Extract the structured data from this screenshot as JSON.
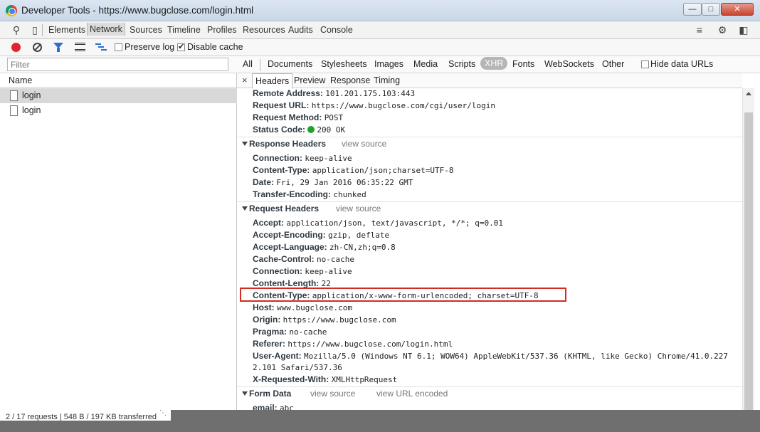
{
  "window": {
    "title": "Developer Tools - https://www.bugclose.com/login.html",
    "min_label": "▭",
    "max_label": "□",
    "close_label": "✕"
  },
  "tabbar": {
    "tabs": [
      "Elements",
      "Network",
      "Sources",
      "Timeline",
      "Profiles",
      "Resources",
      "Audits",
      "Console"
    ],
    "active_tab": "Network"
  },
  "toolbar": {
    "preserve_log_label": "Preserve log",
    "preserve_log_checked": false,
    "disable_cache_label": "Disable cache",
    "disable_cache_checked": true
  },
  "filter": {
    "placeholder": "Filter",
    "types": [
      "All",
      "Documents",
      "Stylesheets",
      "Images",
      "Media",
      "Scripts",
      "XHR",
      "Fonts",
      "WebSockets",
      "Other"
    ],
    "active_type": "XHR",
    "hide_data_urls_label": "Hide data URLs"
  },
  "requests": {
    "column_name": "Name",
    "items": [
      {
        "name": "login",
        "selected": true
      },
      {
        "name": "login",
        "selected": false
      }
    ],
    "status": "2 / 17 requests | 548 B / 197 KB transferred"
  },
  "detail": {
    "close_label": "×",
    "tabs": [
      "Headers",
      "Preview",
      "Response",
      "Timing"
    ],
    "active_tab": "Headers",
    "general": [
      {
        "k": "Remote Address:",
        "v": "101.201.175.103:443"
      },
      {
        "k": "Request URL:",
        "v": "https://www.bugclose.com/cgi/user/login"
      },
      {
        "k": "Request Method:",
        "v": "POST"
      },
      {
        "k": "Status Code:",
        "v": "200 OK"
      }
    ],
    "response_headers": {
      "title": "Response Headers",
      "view_source": "view source",
      "items": [
        {
          "k": "Connection:",
          "v": "keep-alive"
        },
        {
          "k": "Content-Type:",
          "v": "application/json;charset=UTF-8"
        },
        {
          "k": "Date:",
          "v": "Fri, 29 Jan 2016 06:35:22 GMT"
        },
        {
          "k": "Transfer-Encoding:",
          "v": "chunked"
        }
      ]
    },
    "request_headers": {
      "title": "Request Headers",
      "view_source": "view source",
      "items": [
        {
          "k": "Accept:",
          "v": "application/json, text/javascript, */*; q=0.01"
        },
        {
          "k": "Accept-Encoding:",
          "v": "gzip, deflate"
        },
        {
          "k": "Accept-Language:",
          "v": "zh-CN,zh;q=0.8"
        },
        {
          "k": "Cache-Control:",
          "v": "no-cache"
        },
        {
          "k": "Connection:",
          "v": "keep-alive"
        },
        {
          "k": "Content-Length:",
          "v": "22"
        },
        {
          "k": "Content-Type:",
          "v": "application/x-www-form-urlencoded; charset=UTF-8"
        },
        {
          "k": "Host:",
          "v": "www.bugclose.com"
        },
        {
          "k": "Origin:",
          "v": "https://www.bugclose.com"
        },
        {
          "k": "Pragma:",
          "v": "no-cache"
        },
        {
          "k": "Referer:",
          "v": "https://www.bugclose.com/login.html"
        },
        {
          "k": "User-Agent:",
          "v": "Mozilla/5.0 (Windows NT 6.1; WOW64) AppleWebKit/537.36 (KHTML, like Gecko) Chrome/41.0.227"
        },
        {
          "k": "",
          "v": "2.101 Safari/537.36"
        },
        {
          "k": "X-Requested-With:",
          "v": "XMLHttpRequest"
        }
      ]
    },
    "form_data": {
      "title": "Form Data",
      "view_source": "view source",
      "view_url_encoded": "view URL encoded",
      "items": [
        {
          "k": "email:",
          "v": "abc"
        }
      ]
    }
  },
  "colors": {
    "highlight": "#d32a22",
    "status_ok": "#1fa22c",
    "record": "#e0262a"
  }
}
